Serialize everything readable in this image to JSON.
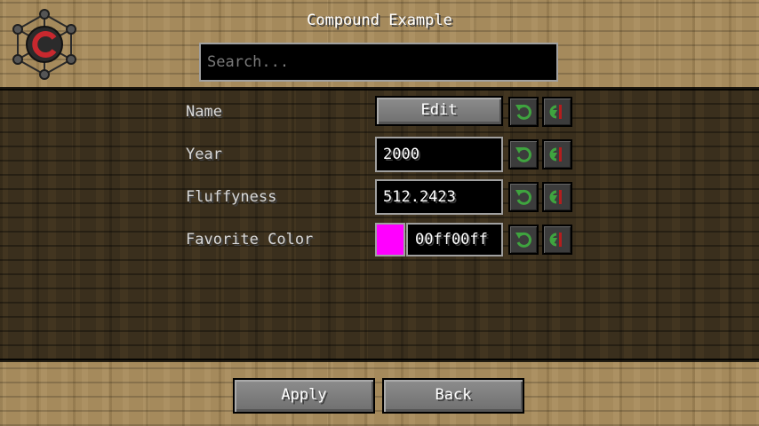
{
  "header": {
    "title": "Compound Example",
    "search_placeholder": "Search..."
  },
  "rows": [
    {
      "label": "Name",
      "control": "button",
      "button_label": "Edit"
    },
    {
      "label": "Year",
      "control": "text",
      "value": "2000"
    },
    {
      "label": "Fluffyness",
      "control": "text",
      "value": "512.2423"
    },
    {
      "label": "Favorite Color",
      "control": "color",
      "value": "00ff00ff",
      "swatch_color": "#ff00ff"
    }
  ],
  "row_icons": [
    "undo-icon",
    "reset-default-icon"
  ],
  "footer": {
    "apply_label": "Apply",
    "back_label": "Back"
  },
  "colors": {
    "icon_green": "#3fa43f",
    "icon_red": "#b51d1d",
    "logo_red": "#c8282e"
  }
}
